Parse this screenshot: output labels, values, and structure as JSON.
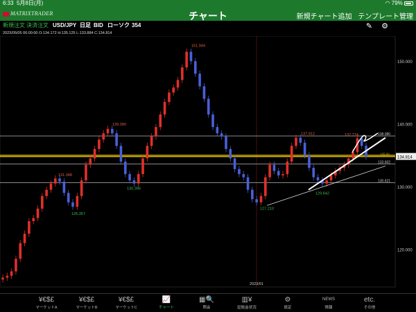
{
  "status": {
    "time": "6:33",
    "date": "5月8日(月)",
    "battery_pct": "79%"
  },
  "nav": {
    "title": "チャート",
    "logo": "MATRIXTRADER",
    "add_chart": "新規チャート追加",
    "template_manage": "テンプレート管理"
  },
  "toolbar": {
    "new_order": "新規注文",
    "settle_order": "決済注文",
    "pair": "USD/JPY",
    "period": "日足",
    "side": "BID",
    "type": "ローソク",
    "count": "354"
  },
  "ohlc": {
    "text": "2023/05/05 00:00:00  O:134.172  H:135.125  L:133.884  C:134.814"
  },
  "chart_data": {
    "type": "candlestick",
    "ylim": [
      114,
      154
    ],
    "y_ticks": [
      "150.000",
      "140.000",
      "130.000",
      "120.000"
    ],
    "x_label": "2023/01",
    "peak_labels": [
      {
        "text": "151.944",
        "color": "#e06040"
      },
      {
        "text": "139.390",
        "color": "#e06040"
      },
      {
        "text": "131.348",
        "color": "#e06040"
      },
      {
        "text": "137.912",
        "color": "#e06040"
      },
      {
        "text": "137.774",
        "color": "#e06040"
      }
    ],
    "trough_labels": [
      {
        "text": "126.357",
        "color": "#3fbf55"
      },
      {
        "text": "130.396",
        "color": "#3fbf55"
      },
      {
        "text": "127.210",
        "color": "#3fbf55"
      },
      {
        "text": "129.642",
        "color": "#3fbf55"
      }
    ],
    "horizontal_lines": [
      "138.080",
      "133.602",
      "130.621"
    ],
    "gold_line_labels": [
      "135.00",
      "134.80"
    ],
    "current_price": "134.814",
    "close_prices": [
      115.5,
      115.8,
      116.5,
      118.5,
      121,
      122.5,
      124.5,
      125,
      126.5,
      128.5,
      129.5,
      130.5,
      131.3,
      130.8,
      129,
      127.5,
      126.8,
      128.5,
      131,
      133.5,
      134.5,
      136,
      137.5,
      138.5,
      139.2,
      138.5,
      136.5,
      134,
      132,
      131,
      130.5,
      132,
      134.5,
      136.5,
      138,
      139.5,
      141.5,
      143.5,
      145,
      145.8,
      147,
      149,
      151.5,
      150,
      148,
      146,
      144,
      141.5,
      139.5,
      138.5,
      138,
      136,
      134.5,
      132.8,
      132,
      131.5,
      129.5,
      128,
      127.5,
      128.5,
      131.5,
      133.5,
      132.5,
      131.8,
      132,
      134,
      136.5,
      137.8,
      137,
      135,
      133,
      131.5,
      131,
      130.5,
      131,
      131.8,
      132.5,
      133,
      133.5,
      134.5,
      135.5,
      137.7,
      136.5,
      134.8
    ]
  },
  "tabs": [
    {
      "label": "マーケットA",
      "icon": "¥€$£"
    },
    {
      "label": "マーケットB",
      "icon": "¥€$£"
    },
    {
      "label": "マーケットC",
      "icon": "¥€$£"
    },
    {
      "label": "チャート",
      "icon": "chart"
    },
    {
      "label": "照会",
      "icon": "search"
    },
    {
      "label": "証拠金状況",
      "icon": "margin"
    },
    {
      "label": "設定",
      "icon": "gear"
    },
    {
      "label": "情報",
      "icon": "NEWS"
    },
    {
      "label": "その他",
      "icon": "etc."
    }
  ],
  "colors": {
    "bar": "#1d7a2c",
    "up": "#e0302a",
    "down": "#4a5fd8",
    "gold": "#d4b400"
  }
}
